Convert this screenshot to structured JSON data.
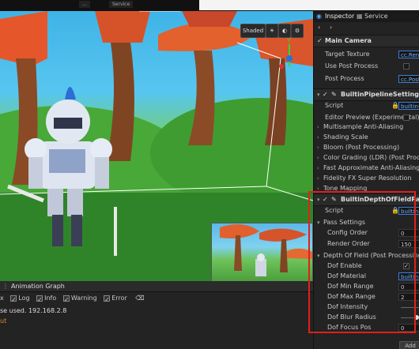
{
  "top_tabs": [
    "...",
    "Service"
  ],
  "viewport": {
    "shaded_label": "Shaded",
    "axis_y_label": "Y"
  },
  "bottom": {
    "title": "Animation Graph",
    "filters": [
      {
        "label": "x",
        "checked": true
      },
      {
        "label": "Log",
        "checked": true
      },
      {
        "label": "Info",
        "checked": true
      },
      {
        "label": "Warning",
        "checked": true
      },
      {
        "label": "Error",
        "checked": true
      }
    ],
    "log_lines": [
      "se used. 192.168.2.8",
      "ut"
    ]
  },
  "inspector": {
    "tab_inspector": "Inspector",
    "tab_service": "Service",
    "node_name": "Main Camera",
    "target_texture_label": "Target Texture",
    "target_texture_value": "cc.Ren",
    "use_post_process_label": "Use Post Process",
    "post_process_label": "Post Process",
    "post_process_value": "cc.Post",
    "pipeline_settings": {
      "title": "BuiltinPipelineSettings",
      "script_label": "Script",
      "script_value": "builtin-",
      "editor_preview_label": "Editor Preview (Experimental)",
      "groups": [
        "Multisample Anti-Aliasing",
        "Shading Scale",
        "Bloom (Post Processing)",
        "Color Grading (LDR) (Post Processing)",
        "Fast Approximate Anti-Aliasing (Post Process",
        "Fidelity FX Super Resolution",
        "Tone Mapping"
      ]
    },
    "dof_pass": {
      "title": "BuiltinDepthOfFieldPass",
      "script_label": "Script",
      "script_value": "builtin-",
      "pass_settings_label": "Pass Settings",
      "config_order_label": "Config Order",
      "config_order_value": "0",
      "render_order_label": "Render Order",
      "render_order_value": "150",
      "dof_section_label": "Depth Of Field (Post Processing)",
      "dof_enable_label": "Dof Enable",
      "dof_material_label": "Dof Material",
      "dof_material_value": "builtin-",
      "dof_min_range_label": "Dof Min Range",
      "dof_min_range_value": "0",
      "dof_max_range_label": "Dof Max Range",
      "dof_max_range_value": "2",
      "dof_intensity_label": "Dof Intensity",
      "dof_blur_radius_label": "Dof Blur Radius",
      "dof_focus_pos_label": "Dof Focus Pos",
      "dof_focus_pos_value": "0"
    },
    "add_component_label": "Add"
  },
  "colors": {
    "highlight": "#e0201c",
    "accent": "#3d7fd6"
  }
}
